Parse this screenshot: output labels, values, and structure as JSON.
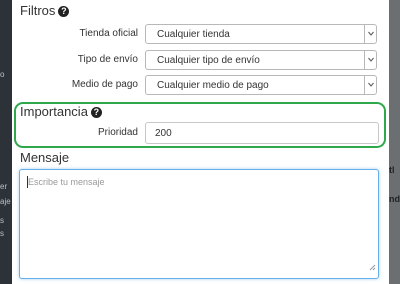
{
  "background": {
    "left_fragments": [
      "o",
      "er",
      "aje",
      "s",
      "s"
    ],
    "right_fragments": [
      "tl",
      "nda"
    ]
  },
  "filters": {
    "title": "Filtros",
    "rows": [
      {
        "label": "Tienda oficial",
        "value": "Cualquier tienda"
      },
      {
        "label": "Tipo de envío",
        "value": "Cualquier tipo de envío"
      },
      {
        "label": "Medio de pago",
        "value": "Cualquier medio de pago"
      }
    ]
  },
  "importance": {
    "title": "Importancia",
    "priority_label": "Prioridad",
    "priority_value": "200"
  },
  "message": {
    "title": "Mensaje",
    "placeholder": "Escribe tu mensaje"
  },
  "colors": {
    "highlight": "#2ea84a",
    "focus": "#66afe9"
  }
}
